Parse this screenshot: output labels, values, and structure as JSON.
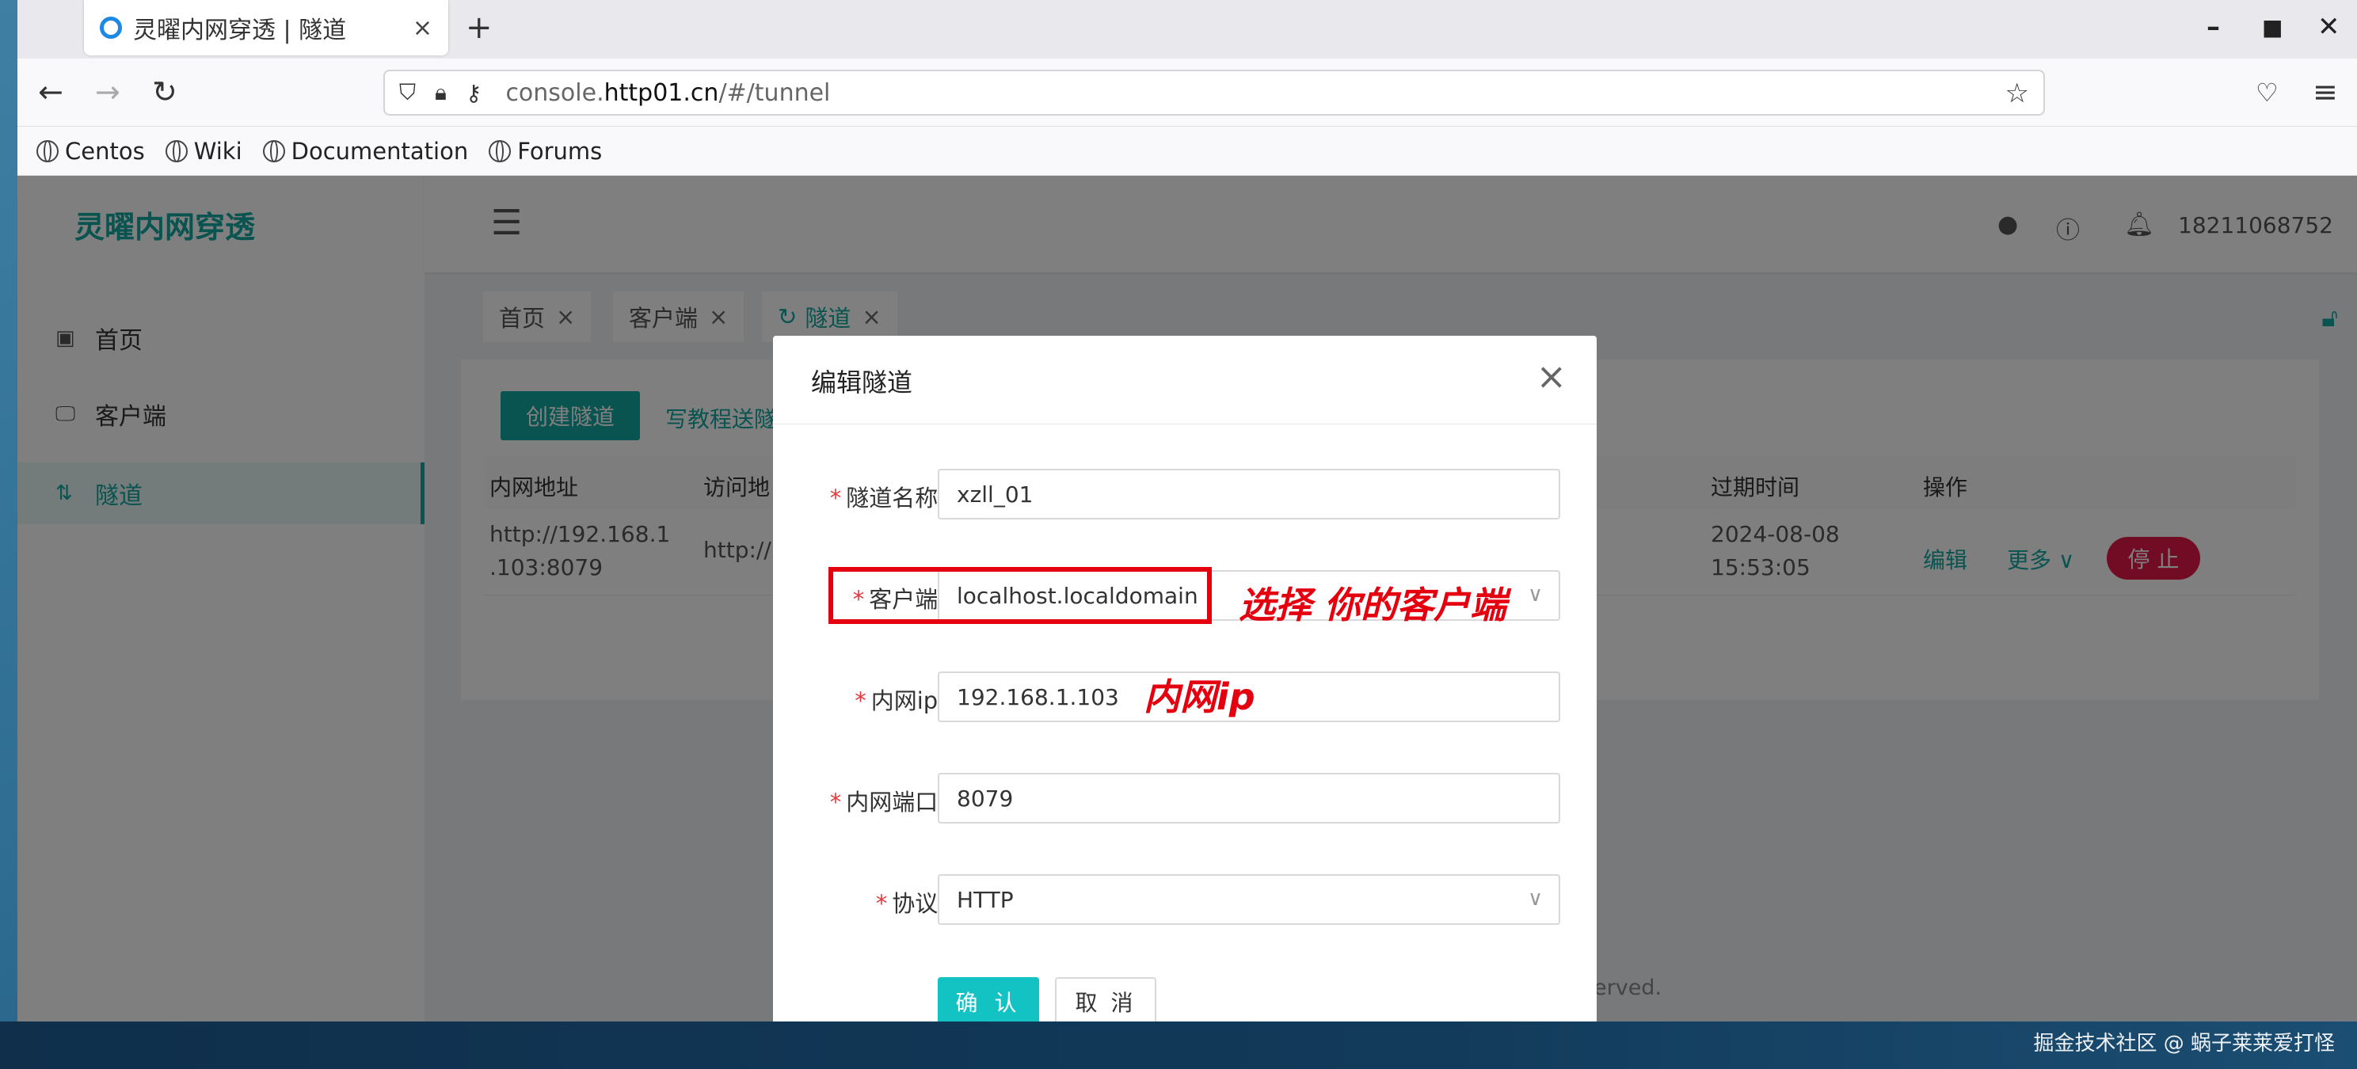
{
  "browser": {
    "tab_title": "灵曜内网穿透 | 隧道",
    "tab_close": "×",
    "new_tab": "+",
    "url_host": "console.",
    "url_domain": "http01.cn",
    "url_path": "/#/tunnel",
    "bookmarks": [
      "Centos",
      "Wiki",
      "Documentation",
      "Forums"
    ]
  },
  "app": {
    "brand": "灵曜内网穿透",
    "sidebar": [
      {
        "label": "首页",
        "icon": "dashboard-icon"
      },
      {
        "label": "客户端",
        "icon": "monitor-icon"
      },
      {
        "label": "隧道",
        "icon": "swap-icon"
      }
    ],
    "phone": "18211068752",
    "tags": [
      {
        "label": "首页"
      },
      {
        "label": "客户端"
      },
      {
        "label": "隧道"
      }
    ],
    "create_button": "创建隧道",
    "tutorial_link": "写教程送隧",
    "table": {
      "headers": [
        "内网地址",
        "访问地",
        "过期时间",
        "操作"
      ],
      "row": {
        "internal_addr": "http://192.168.1\n.103:8079",
        "access_addr": "http://",
        "expire": "2024-08-08\n15:53:05",
        "edit": "编辑",
        "more": "更多 ∨",
        "stop": "停 止"
      }
    },
    "footer_text": "erved."
  },
  "modal": {
    "title": "编辑隧道",
    "fields": [
      {
        "label": "隧道名称:",
        "value": "xzll_01",
        "type": "text"
      },
      {
        "label": "客户端:",
        "value": "localhost.localdomain",
        "type": "select"
      },
      {
        "label": "内网ip:",
        "value": "192.168.1.103",
        "type": "text"
      },
      {
        "label": "内网端口:",
        "value": "8079",
        "type": "text"
      },
      {
        "label": "协议:",
        "value": "HTTP",
        "type": "select"
      }
    ],
    "ok": "确 认",
    "cancel": "取 消"
  },
  "annotations": {
    "client_note": "选择  你的客户端",
    "ip_note": "内网ip"
  },
  "watermark": "掘金技术社区 @ 蜗子莱莱爱打怪",
  "colors": {
    "accent": "#13a8a0",
    "danger": "#e41749",
    "annotation": "#e4000f"
  }
}
